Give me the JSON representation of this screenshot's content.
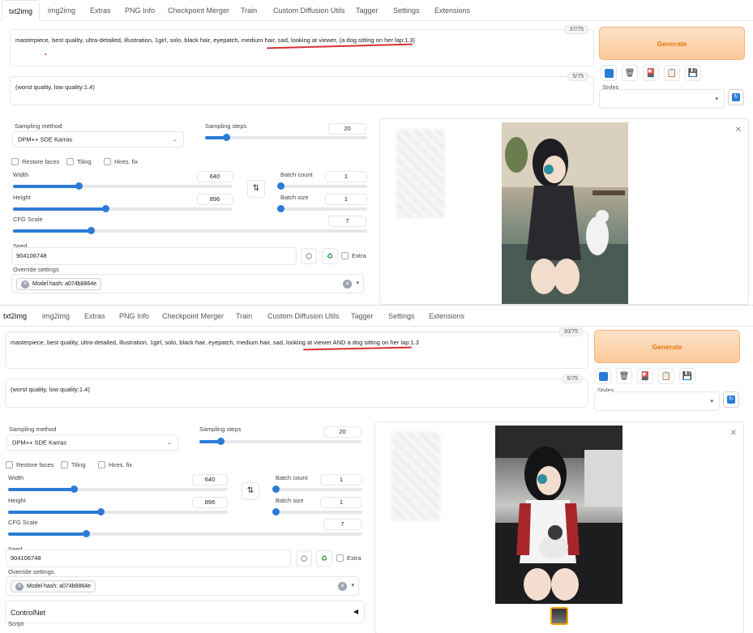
{
  "tabs": [
    "txt2img",
    "img2img",
    "Extras",
    "PNG Info",
    "Checkpoint Merger",
    "Train",
    "Custom Diffusion Utils",
    "Tagger",
    "Settings",
    "Extensions"
  ],
  "active_tab": "txt2img",
  "colors": {
    "accent": "#2b7bd6",
    "generate": "#e3790e",
    "annotation": "#d63232"
  },
  "icons": [
    "paint-icon",
    "trash-icon",
    "card-icon",
    "clipboard-icon",
    "save-icon",
    "swap-icon",
    "dice-icon",
    "recycle-icon",
    "refresh-icon",
    "close-icon"
  ],
  "panel1": {
    "positive_prompt": "masterpiece, best quality, ultra-detailed, illustration, 1girl, solo, black hair, eyepatch, medium hair, sad, looking at viewer, (a dog sitting on her lap:1.3)",
    "positive_tokens": "37/75",
    "negative_prompt": "(worst quality, low quality:1.4)",
    "negative_tokens": "5/75",
    "generate_label": "Generate",
    "styles_label": "Styles",
    "sampling_method_label": "Sampling method",
    "sampling_method": "DPM++ SDE Karras",
    "sampling_steps_label": "Sampling steps",
    "sampling_steps": "20",
    "restore_faces": "Restore faces",
    "tiling": "Tiling",
    "hires_fix": "Hires. fix",
    "width_label": "Width",
    "width": "640",
    "height_label": "Height",
    "height": "896",
    "batch_count_label": "Batch count",
    "batch_count": "1",
    "batch_size_label": "Batch size",
    "batch_size": "1",
    "cfg_label": "CFG Scale",
    "cfg": "7",
    "seed_label": "Seed",
    "seed": "904106748",
    "extra_label": "Extra",
    "override_label": "Override settings",
    "model_hash": "Model hash: a074b8864e"
  },
  "panel2": {
    "positive_prompt": "masterpiece, best quality, ultra-detailed, illustration, 1girl, solo, black hair, eyepatch, medium hair, sad, looking at viewer AND a dog sitting on her lap:1.3",
    "positive_tokens": "30/75",
    "negative_prompt": "(worst quality, low quality:1.4)",
    "negative_tokens": "5/75",
    "generate_label": "Generate",
    "styles_label": "Styles",
    "sampling_method_label": "Sampling method",
    "sampling_method": "DPM++ SDE Karras",
    "sampling_steps_label": "Sampling steps",
    "sampling_steps": "20",
    "restore_faces": "Restore faces",
    "tiling": "Tiling",
    "hires_fix": "Hires. fix",
    "width_label": "Width",
    "width": "640",
    "height_label": "Height",
    "height": "896",
    "batch_count_label": "Batch count",
    "batch_count": "1",
    "batch_size_label": "Batch size",
    "batch_size": "1",
    "cfg_label": "CFG Scale",
    "cfg": "7",
    "seed_label": "Seed",
    "seed": "904106748",
    "extra_label": "Extra",
    "override_label": "Override settings",
    "model_hash": "Model hash: a074b8864e",
    "controlnet_label": "ControlNet",
    "script_label": "Script"
  },
  "sliders": {
    "sampling_steps": 0.13,
    "width": 0.3,
    "height": 0.42,
    "batch_count": 0.0,
    "batch_size": 0.0,
    "cfg": 0.22
  }
}
